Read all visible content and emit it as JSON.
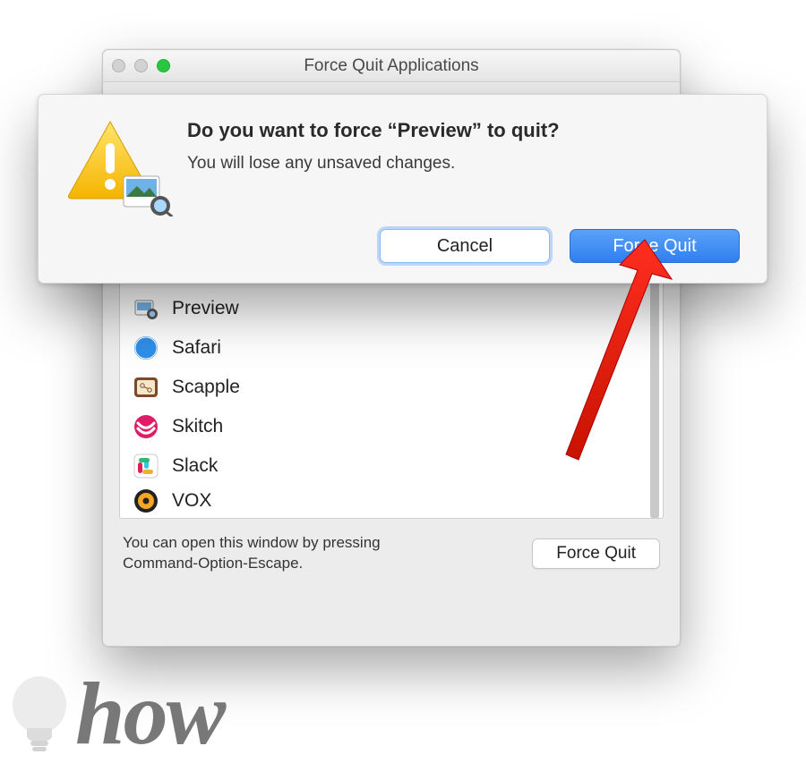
{
  "window": {
    "title": "Force Quit Applications",
    "hint": "You can open this window by pressing Command-Option-Escape.",
    "force_quit_label": "Force Quit"
  },
  "apps": [
    {
      "name": "Preview",
      "icon": "preview-icon"
    },
    {
      "name": "Safari",
      "icon": "safari-icon"
    },
    {
      "name": "Scapple",
      "icon": "scapple-icon"
    },
    {
      "name": "Skitch",
      "icon": "skitch-icon"
    },
    {
      "name": "Slack",
      "icon": "slack-icon"
    },
    {
      "name": "VOX",
      "icon": "vox-icon"
    }
  ],
  "dialog": {
    "title": "Do you want to force “Preview” to quit?",
    "message": "You will lose any unsaved changes.",
    "cancel_label": "Cancel",
    "confirm_label": "Force Quit"
  },
  "watermark": {
    "text": "how"
  }
}
